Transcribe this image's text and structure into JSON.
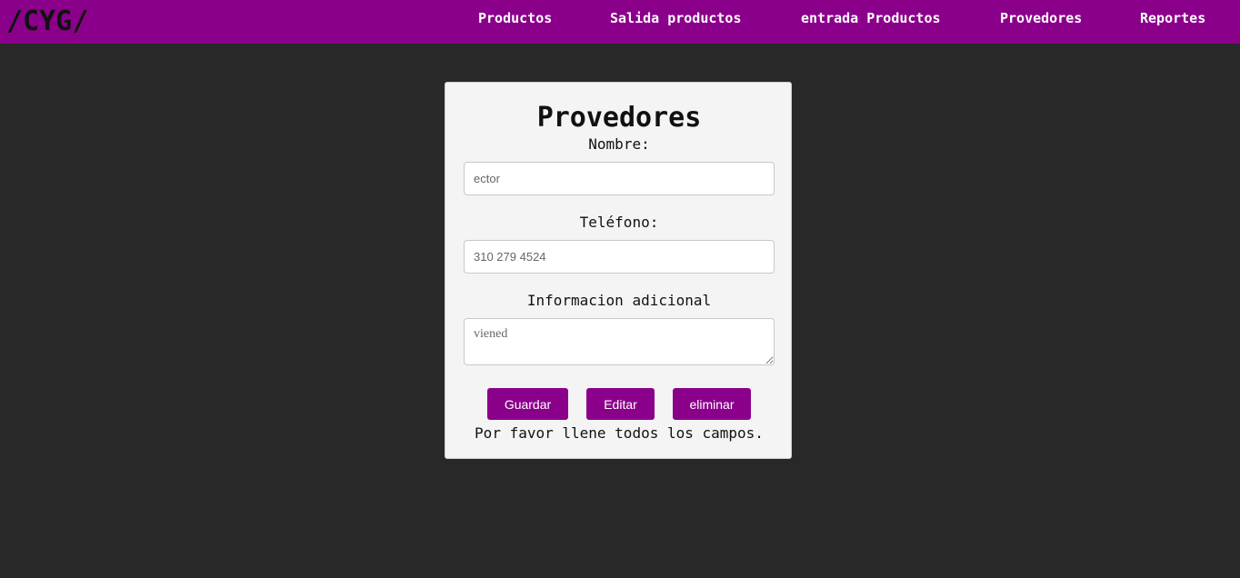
{
  "header": {
    "logo": "/CYG/",
    "nav": [
      {
        "label": "Productos"
      },
      {
        "label": "Salida productos"
      },
      {
        "label": "entrada Productos"
      },
      {
        "label": "Provedores"
      },
      {
        "label": "Reportes"
      }
    ]
  },
  "form": {
    "title": "Provedores",
    "name_label": "Nombre:",
    "name_placeholder": "ector",
    "phone_label": "Teléfono:",
    "phone_placeholder": "310 279 4524",
    "info_label": "Informacion adicional",
    "info_placeholder": "viened",
    "buttons": {
      "save": "Guardar",
      "edit": "Editar",
      "delete": "eliminar"
    },
    "message": "Por favor llene todos los campos."
  },
  "colors": {
    "brand": "#8b008b",
    "background": "#282828",
    "card": "#f4f4f4"
  }
}
